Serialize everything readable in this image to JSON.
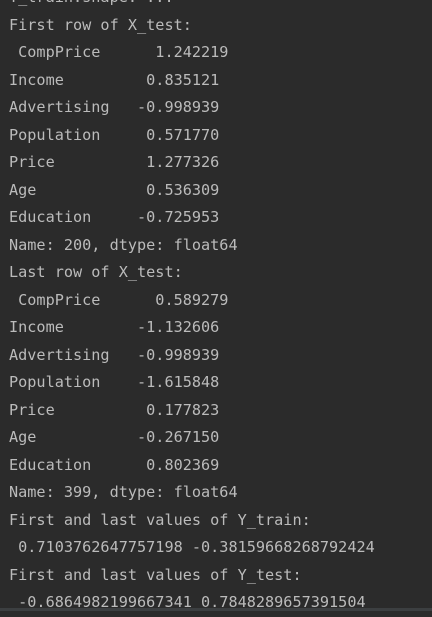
{
  "console": {
    "lines": [
      "Y_train.shape: ...",
      "First row of X_test:",
      " CompPrice      1.242219",
      "Income         0.835121",
      "Advertising   -0.998939",
      "Population     0.571770",
      "Price          1.277326",
      "Age            0.536309",
      "Education     -0.725953",
      "Name: 200, dtype: float64",
      "Last row of X_test:",
      " CompPrice      0.589279",
      "Income        -1.132606",
      "Advertising   -0.998939",
      "Population    -1.615848",
      "Price          0.177823",
      "Age           -0.267150",
      "Education      0.802369",
      "Name: 399, dtype: float64",
      "First and last values of Y_train:",
      " 0.7103762647757198 -0.38159668268792424",
      "First and last values of Y_test:",
      " -0.6864982199667341 0.7848289657391504"
    ]
  },
  "colors": {
    "background": "#2b2b2b",
    "text": "#bbbbbb"
  }
}
